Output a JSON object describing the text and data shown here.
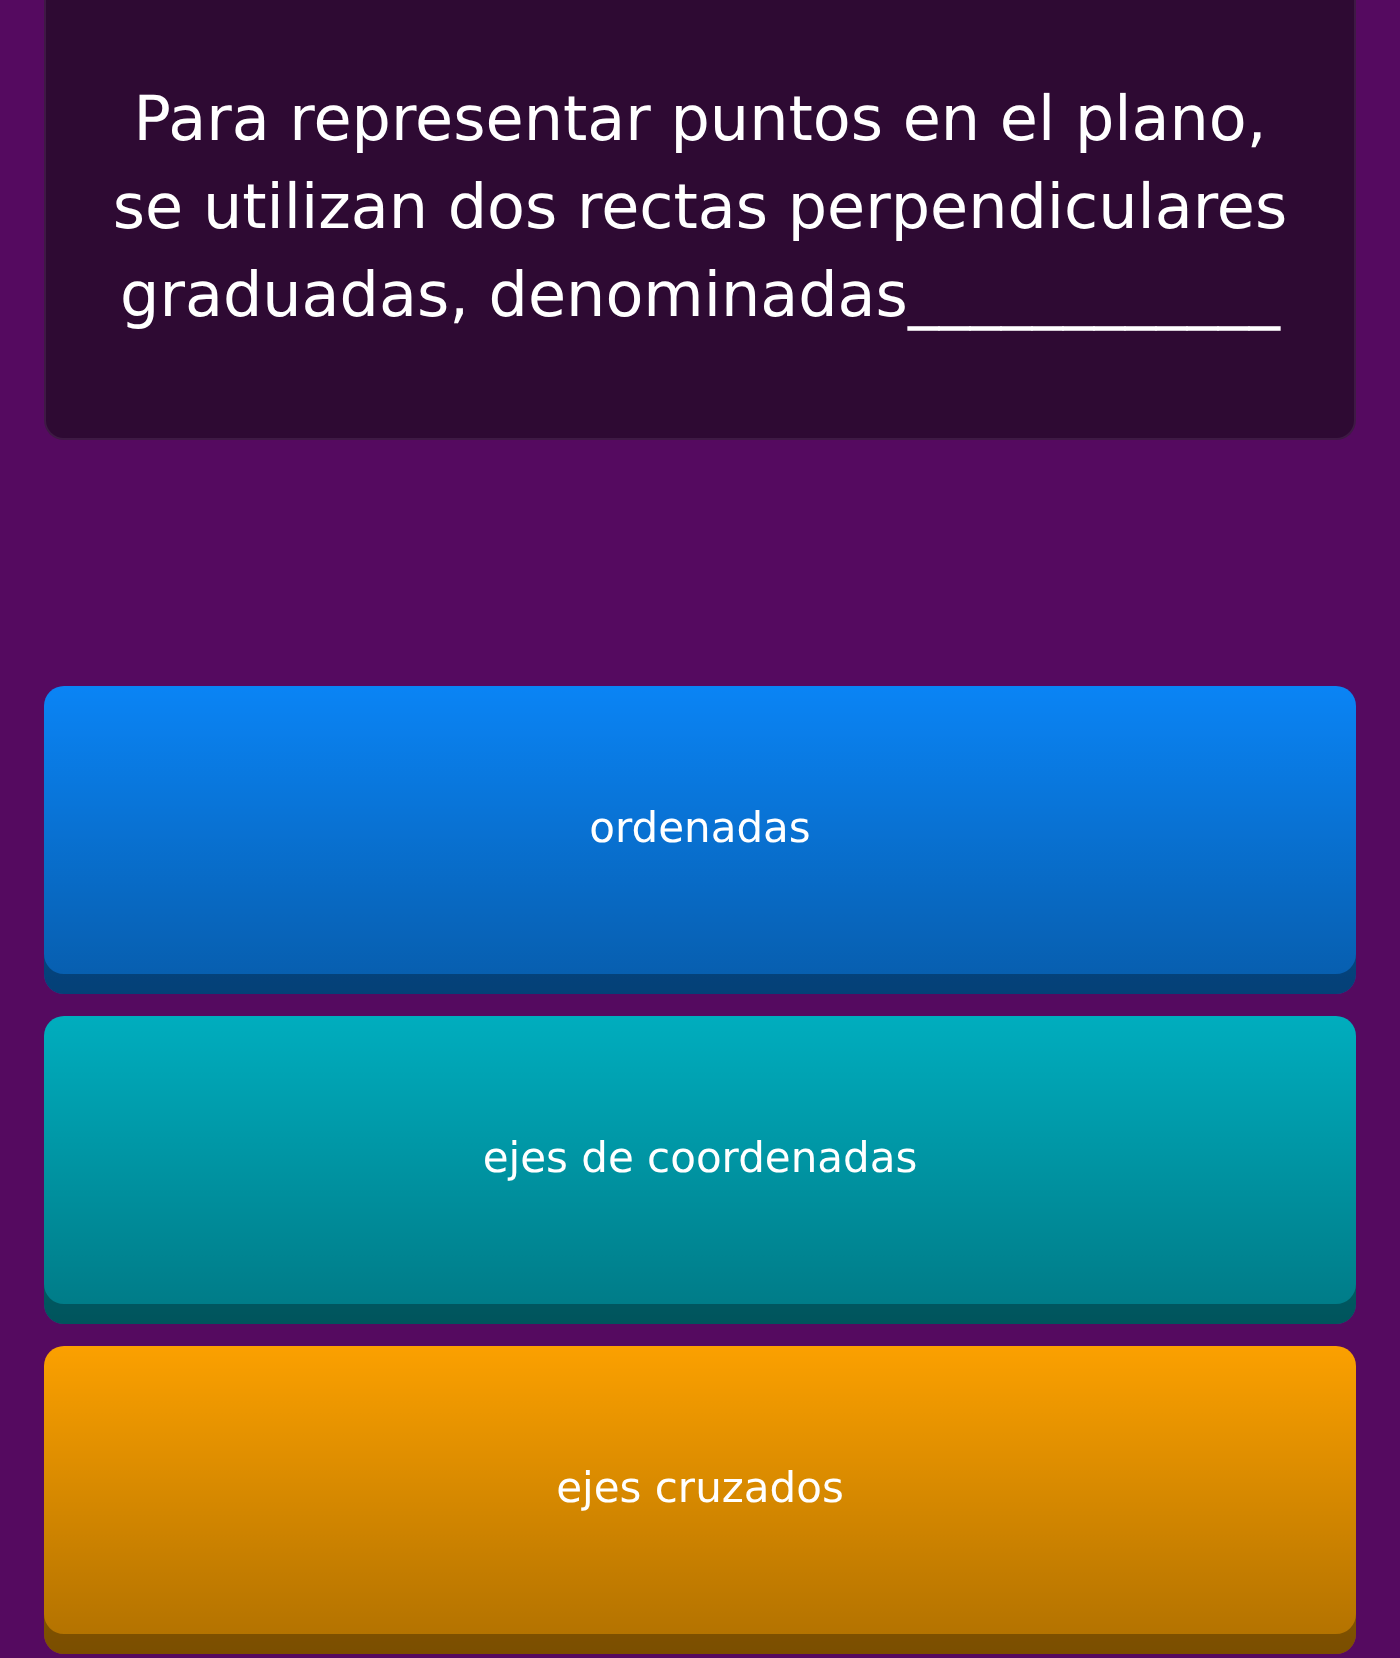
{
  "question": {
    "text": "Para representar puntos en el plano, se utilizan dos rectas perpendiculares graduadas, denominadas____________"
  },
  "options": [
    {
      "label": "ordenadas",
      "color": "#0a84f5"
    },
    {
      "label": "ejes de coordenadas",
      "color": "#00adbe"
    },
    {
      "label": "ejes cruzados",
      "color": "#fba000"
    }
  ]
}
